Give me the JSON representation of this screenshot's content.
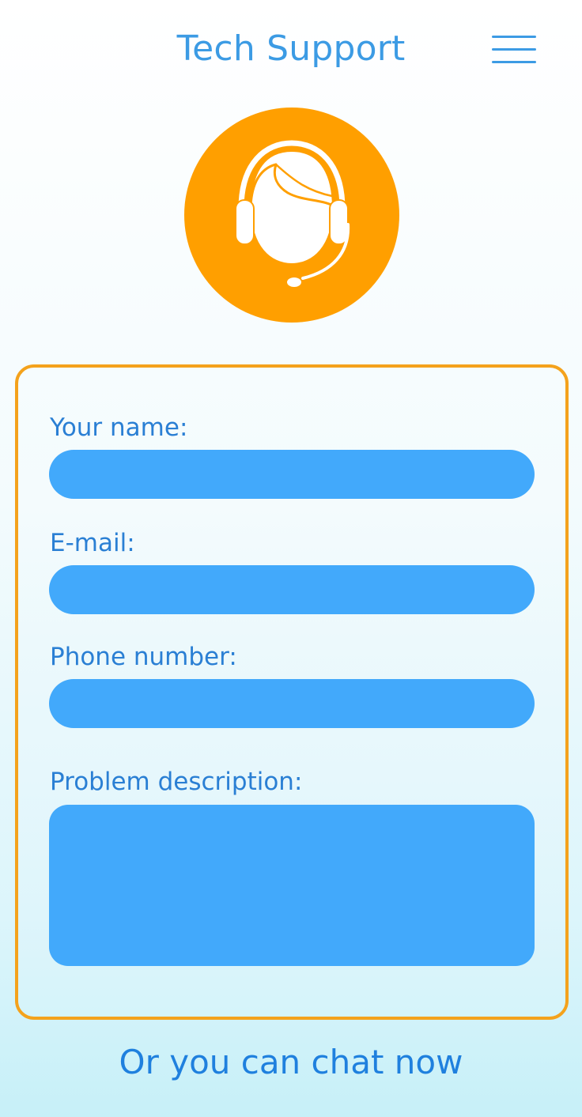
{
  "header": {
    "title": "Tech Support",
    "menu_icon": "hamburger-menu-icon"
  },
  "avatar": {
    "icon": "support-agent-headset-icon"
  },
  "form": {
    "name_label": "Your name:",
    "name_value": "",
    "email_label": "E-mail:",
    "email_value": "",
    "phone_label": "Phone number:",
    "phone_value": "",
    "problem_label": "Problem description:",
    "problem_value": ""
  },
  "chat": {
    "link_text": "Or you can chat now"
  },
  "colors": {
    "accent_blue": "#3c9be4",
    "input_blue": "#42a9fb",
    "brand_orange": "#ff9f00",
    "card_border": "#f4a21c"
  }
}
